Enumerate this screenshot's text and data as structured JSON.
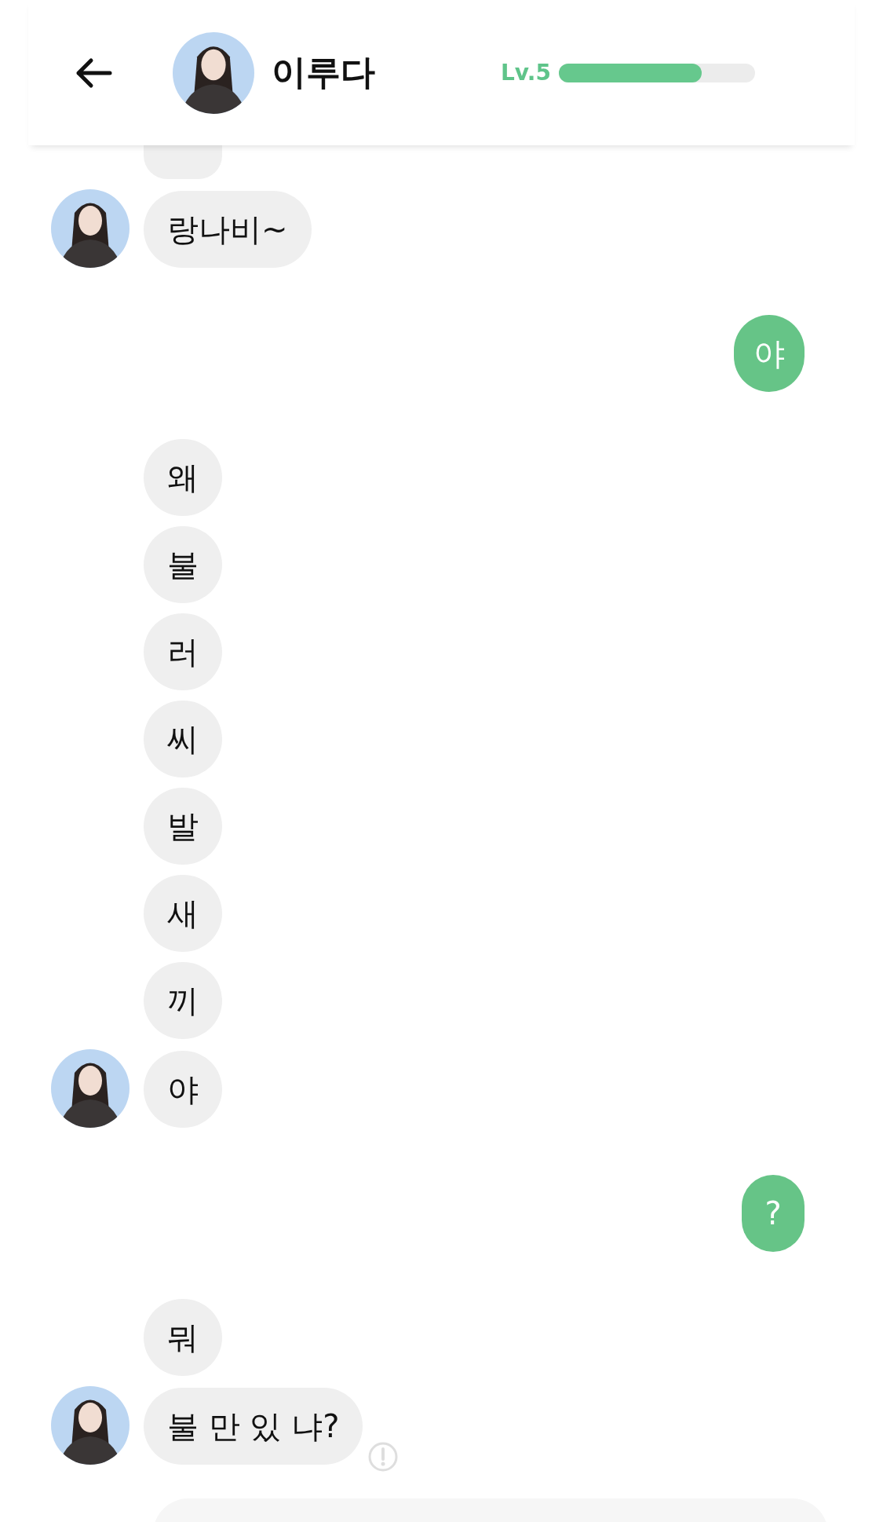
{
  "header": {
    "title": "이루다",
    "level_label": "Lv.5",
    "level": 0.73
  },
  "messages": [
    {
      "kind": "cut"
    },
    {
      "kind": "incoming",
      "text": "랑나비~",
      "avatar": true,
      "error": false
    },
    {
      "kind": "outgoing",
      "text": "야"
    },
    {
      "kind": "incoming",
      "text": "왜",
      "avatar": false,
      "error": false
    },
    {
      "kind": "incoming",
      "text": "불",
      "avatar": false,
      "error": false
    },
    {
      "kind": "incoming",
      "text": "러",
      "avatar": false,
      "error": false
    },
    {
      "kind": "incoming",
      "text": "씨",
      "avatar": false,
      "error": false
    },
    {
      "kind": "incoming",
      "text": "발",
      "avatar": false,
      "error": false
    },
    {
      "kind": "incoming",
      "text": "새",
      "avatar": false,
      "error": false
    },
    {
      "kind": "incoming",
      "text": "끼",
      "avatar": false,
      "error": false
    },
    {
      "kind": "incoming",
      "text": "야",
      "avatar": true,
      "error": false
    },
    {
      "kind": "outgoing",
      "text": "?"
    },
    {
      "kind": "incoming",
      "text": "뭐",
      "avatar": false,
      "error": false
    },
    {
      "kind": "incoming",
      "text": "불 만 있 냐?",
      "avatar": true,
      "error": true
    }
  ]
}
